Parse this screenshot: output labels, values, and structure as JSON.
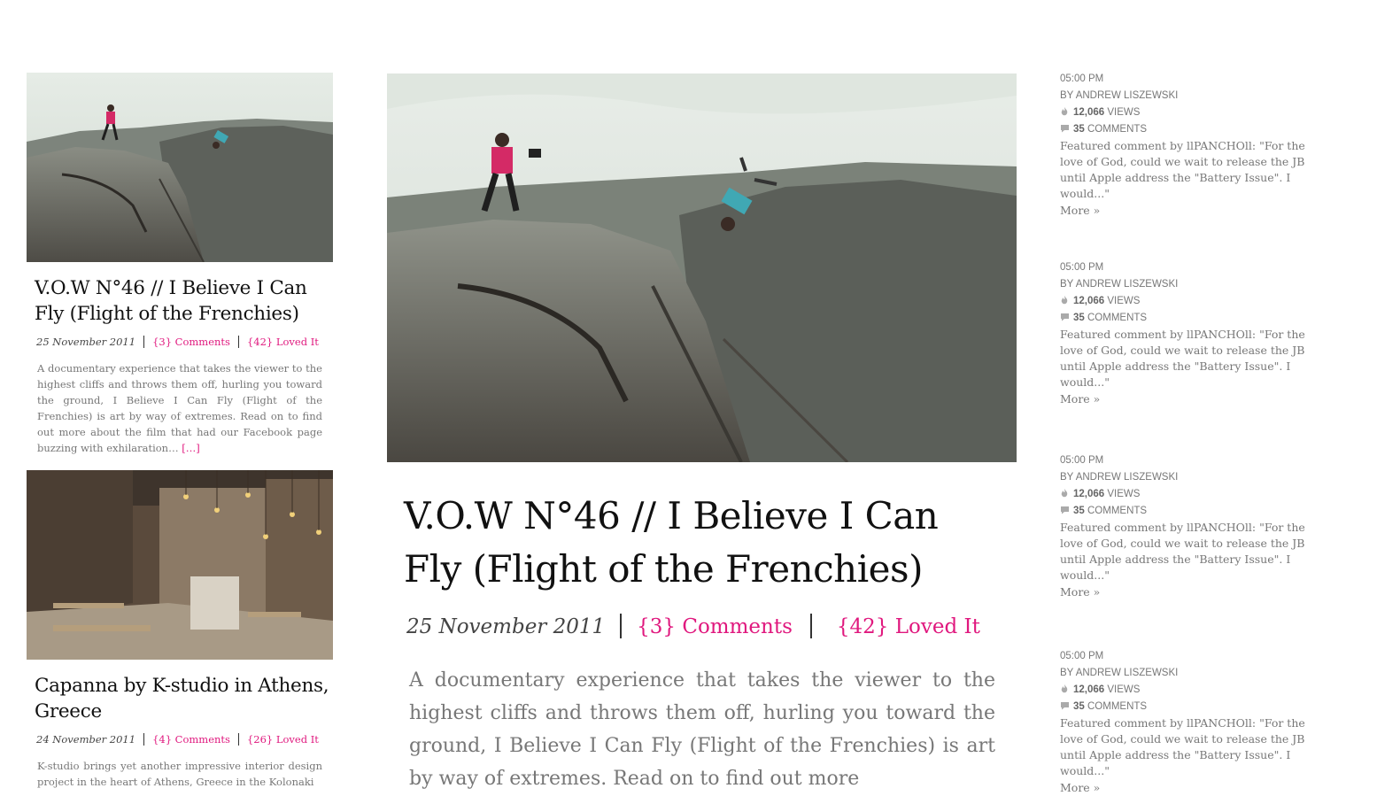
{
  "left_posts": [
    {
      "title": "V.O.W N°46 // I Believe I Can Fly (Flight of the Frenchies)",
      "date": "25 November 2011",
      "comments": "{3} Comments",
      "loved": "{42} Loved It",
      "excerpt": "A documentary experience that takes the viewer to the highest cliffs and throws them off, hurling you toward the ground, I Believe I Can Fly (Flight of the Frenchies) is art by way of extremes. Read on to find out more about the film that had our Facebook page buzzing with exhilaration…",
      "more": "[…]"
    },
    {
      "title": "Capanna by K-studio in Athens, Greece",
      "date": "24 November 2011",
      "comments": "{4} Comments",
      "loved": "{26} Loved It",
      "excerpt": "K-studio brings yet another impressive interior design project in the heart of Athens, Greece in the Kolonaki"
    }
  ],
  "feature": {
    "title": "V.O.W N°46 // I Believe I Can Fly (Flight of the Frenchies)",
    "date": "25 November 2011",
    "comments": "{3} Comments",
    "loved": "{42} Loved It",
    "excerpt": "A documentary experience that takes the viewer to the highest cliffs and throws them off, hurling you toward the ground, I Believe I Can Fly (Flight of the Frenchies) is art by way of extremes. Read on to find out more"
  },
  "sidebar": [
    {
      "time": "05:00 PM",
      "author": "BY ANDREW LISZEWSKI",
      "views_count": "12,066",
      "views_label": "VIEWS",
      "comments_count": "35",
      "comments_label": "COMMENTS",
      "featured_comment": "Featured comment by llPANCHOll: \"For the love of God, could we wait to release the JB until Apple address the \"Battery Issue\". I would...\"",
      "more": "More »"
    },
    {
      "time": "05:00 PM",
      "author": "BY ANDREW LISZEWSKI",
      "views_count": "12,066",
      "views_label": "VIEWS",
      "comments_count": "35",
      "comments_label": "COMMENTS",
      "featured_comment": "Featured comment by llPANCHOll: \"For the love of God, could we wait to release the JB until Apple address the \"Battery Issue\". I would...\"",
      "more": "More »"
    },
    {
      "time": "05:00 PM",
      "author": "BY ANDREW LISZEWSKI",
      "views_count": "12,066",
      "views_label": "VIEWS",
      "comments_count": "35",
      "comments_label": "COMMENTS",
      "featured_comment": "Featured comment by llPANCHOll: \"For the love of God, could we wait to release the JB until Apple address the \"Battery Issue\". I would...\"",
      "more": "More »"
    },
    {
      "time": "05:00 PM",
      "author": "BY ANDREW LISZEWSKI",
      "views_count": "12,066",
      "views_label": "VIEWS",
      "comments_count": "35",
      "comments_label": "COMMENTS",
      "featured_comment": "Featured comment by llPANCHOll: \"For the love of God, could we wait to release the JB until Apple address the \"Battery Issue\". I would...\"",
      "more": "More »"
    }
  ],
  "colors": {
    "accent": "#e0187e",
    "text_muted": "#777777"
  },
  "icons": {
    "views": "flame-icon",
    "comments": "speech-bubble-icon"
  }
}
